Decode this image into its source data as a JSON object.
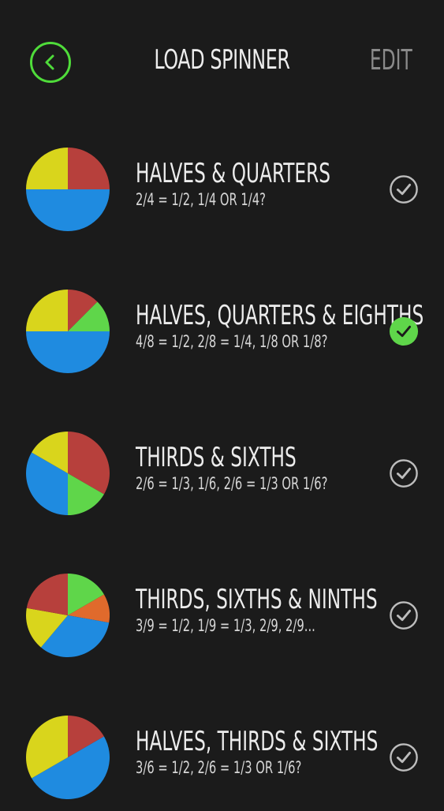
{
  "header": {
    "title": "LOAD SPINNER",
    "edit_label": "EDIT",
    "back_icon": "chevron-left-circle-icon"
  },
  "colors": {
    "accent": "#4fdc3a",
    "red": "#b7403c",
    "yellow": "#d9d51c",
    "blue": "#1f8be0",
    "green": "#5fd64a",
    "orange": "#e06a2c",
    "background": "#1b1b1b"
  },
  "spinners": [
    {
      "name": "HALVES & QUARTERS",
      "subtitle": "2/4 = 1/2, 1/4 OR 1/4?",
      "selected": false,
      "slices": [
        [
          "red",
          0.25
        ],
        [
          "blue",
          0.5
        ],
        [
          "yellow",
          0.25
        ]
      ]
    },
    {
      "name": "HALVES, QUARTERS & EIGHTHS",
      "subtitle": "4/8 = 1/2, 2/8 = 1/4, 1/8 OR 1/8?",
      "selected": true,
      "slices": [
        [
          "red",
          0.125
        ],
        [
          "green",
          0.125
        ],
        [
          "blue",
          0.5
        ],
        [
          "yellow",
          0.25
        ]
      ]
    },
    {
      "name": "THIRDS & SIXTHS",
      "subtitle": "2/6 = 1/3, 1/6, 2/6 = 1/3 OR 1/6?",
      "selected": false,
      "slices": [
        [
          "red",
          0.3333
        ],
        [
          "green",
          0.1667
        ],
        [
          "blue",
          0.3333
        ],
        [
          "yellow",
          0.1667
        ]
      ]
    },
    {
      "name": "THIRDS, SIXTHS & NINTHS",
      "subtitle": "3/9 = 1/2, 1/9 = 1/3, 2/9, 2/9...",
      "selected": false,
      "slices": [
        [
          "green",
          0.1667
        ],
        [
          "orange",
          0.1111
        ],
        [
          "blue",
          0.3333
        ],
        [
          "yellow",
          0.1667
        ],
        [
          "red",
          0.2222
        ]
      ]
    },
    {
      "name": "HALVES, THIRDS & SIXTHS",
      "subtitle": "3/6 = 1/2, 2/6 = 1/3 OR 1/6?",
      "selected": false,
      "slices": [
        [
          "red",
          0.1667
        ],
        [
          "blue",
          0.5
        ],
        [
          "yellow",
          0.3333
        ]
      ]
    }
  ]
}
